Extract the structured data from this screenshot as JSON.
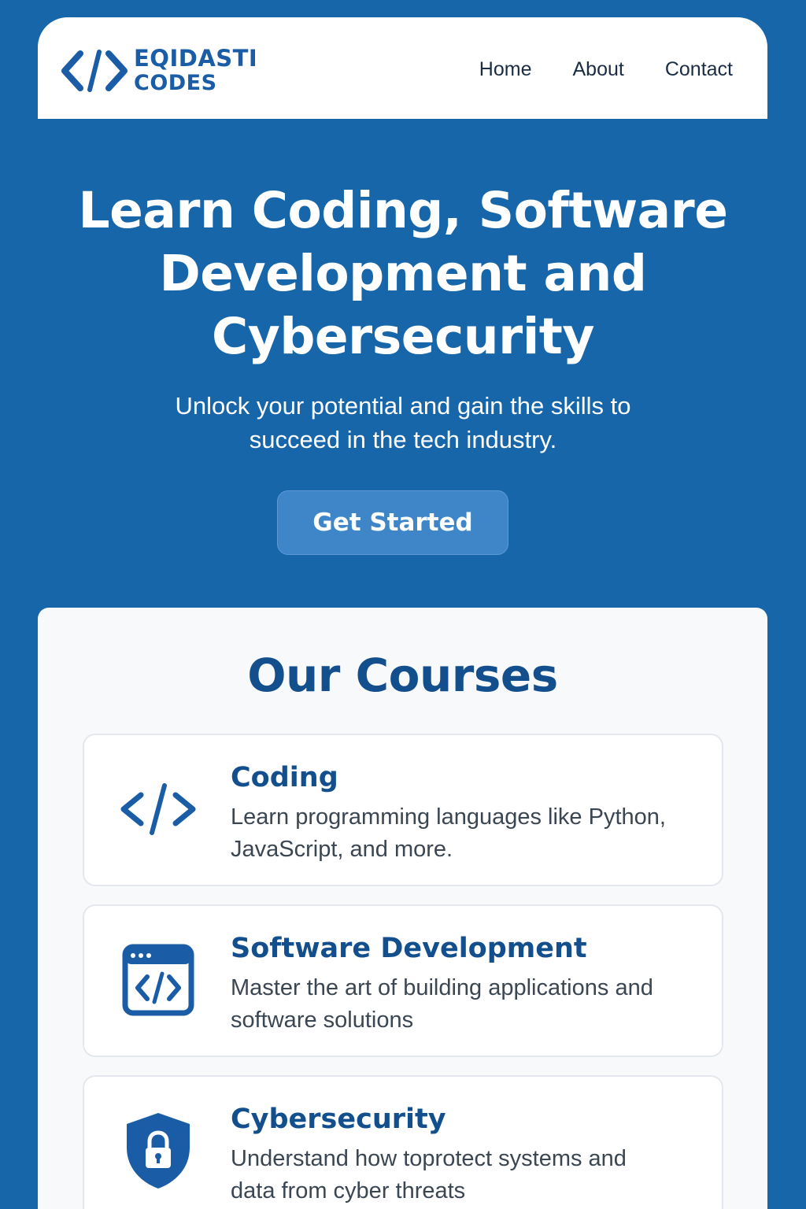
{
  "brand": {
    "line1": "EQIDASTI",
    "line2": "CODES",
    "icon": "code-brackets-icon"
  },
  "nav": {
    "items": [
      {
        "label": "Home"
      },
      {
        "label": "About"
      },
      {
        "label": "Contact"
      }
    ]
  },
  "hero": {
    "title": "Learn Coding, Software Development and Cybersecurity",
    "subtitle": "Unlock your potential and gain the skills to succeed in the tech industry.",
    "cta_label": "Get Started"
  },
  "courses": {
    "heading": "Our Courses",
    "items": [
      {
        "icon": "code-brackets-icon",
        "title": "Coding",
        "description": "Learn programming languages like Python, JavaScript, and more."
      },
      {
        "icon": "browser-code-icon",
        "title": "Software Development",
        "description": "Master the art of building applications and software solutions"
      },
      {
        "icon": "shield-lock-icon",
        "title": "Cybersecurity",
        "description": "Understand how toprotect systems and data from cyber threats"
      }
    ]
  },
  "colors": {
    "background": "#1766aa",
    "brand": "#1a5da6",
    "heading": "#134f8c",
    "cta": "#3f86c8",
    "panel": "#f8f9fb"
  }
}
